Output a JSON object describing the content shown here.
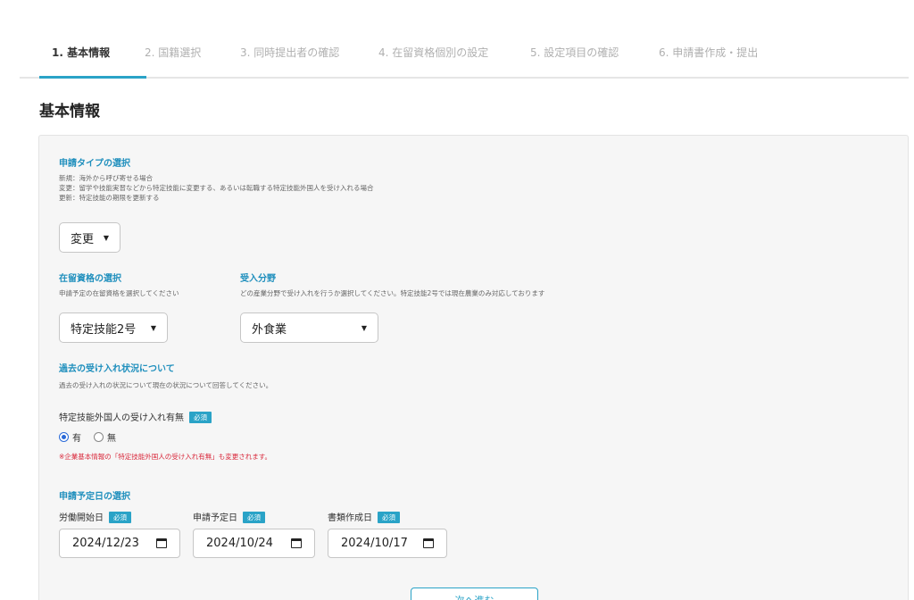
{
  "steps": [
    {
      "label": "1. 基本情報"
    },
    {
      "label": "2. 国籍選択"
    },
    {
      "label": "3. 同時提出者の確認"
    },
    {
      "label": "4. 在留資格個別の設定"
    },
    {
      "label": "5. 設定項目の確認"
    },
    {
      "label": "6. 申請書作成・提出"
    }
  ],
  "page_title": "基本情報",
  "application_type": {
    "title": "申請タイプの選択",
    "desc": [
      "新規：海外から呼び寄せる場合",
      "変更：留学や技能実習などから特定技能に変更する、あるいは転職する特定技能外国人を受け入れる場合",
      "更新：特定技能の期限を更新する"
    ],
    "selected": "変更"
  },
  "residence_status": {
    "title": "在留資格の選択",
    "desc": "申請予定の在留資格を選択してください",
    "selected": "特定技能2号"
  },
  "field": {
    "title": "受入分野",
    "desc": "どの産業分野で受け入れを行うか選択してください。特定技能2号では現在農業のみ対応しております",
    "selected": "外食業"
  },
  "past_acceptance": {
    "title": "過去の受け入れ状況について",
    "desc": "過去の受け入れの状況について現在の状況について回答してください。",
    "question": "特定技能外国人の受け入れ有無",
    "required": "必須",
    "options": [
      {
        "label": "有"
      },
      {
        "label": "無"
      }
    ],
    "selected_index": 0,
    "note": "※企業基本情報の「特定技能外国人の受け入れ有無」も変更されます。"
  },
  "schedule": {
    "title": "申請予定日の選択",
    "fields": [
      {
        "label": "労働開始日",
        "required": "必須",
        "value": "2024/12/23"
      },
      {
        "label": "申請予定日",
        "required": "必須",
        "value": "2024/10/24"
      },
      {
        "label": "書類作成日",
        "required": "必須",
        "value": "2024/10/17"
      }
    ]
  },
  "next_button": {
    "label": "次へ進む"
  }
}
